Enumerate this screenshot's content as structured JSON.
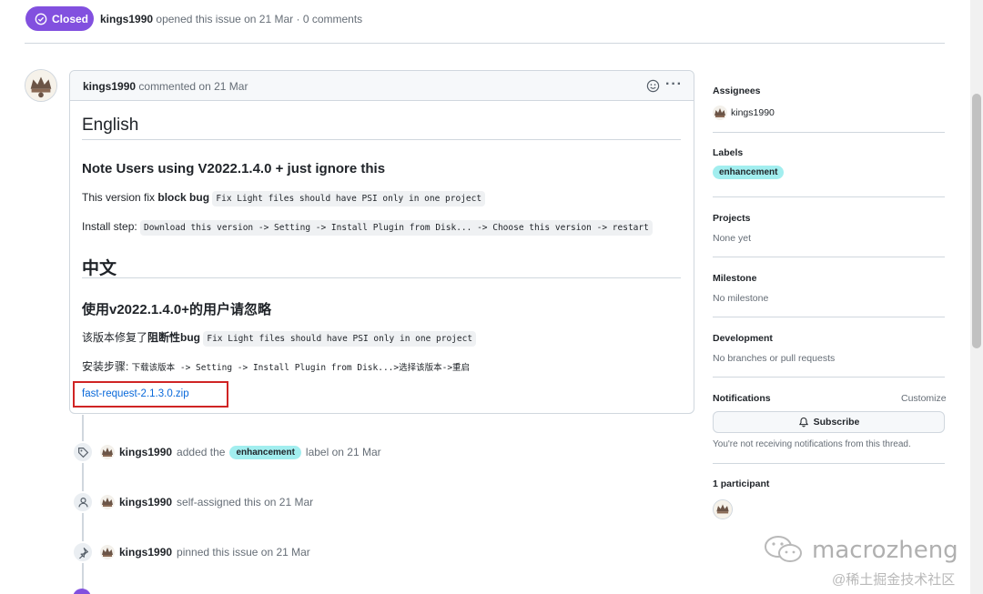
{
  "header": {
    "state": "Closed",
    "author": "kings1990",
    "meta": "opened this issue on 21 Mar · 0 comments"
  },
  "comment": {
    "author": "kings1990",
    "meta": "commented on 21 Mar",
    "more": "···",
    "h1_en": "English",
    "h2_en": "Note Users using V2022.1.4.0 + just ignore this",
    "p1_prefix": "This version fix ",
    "p1_bold": "block bug",
    "p1_code": "Fix Light files should have PSI only in one project",
    "p2_prefix": "Install step: ",
    "p2_code": "Download this version -> Setting -> Install Plugin from Disk... -> Choose this version -> restart",
    "h1_zh": "中文",
    "h2_zh": "使用v2022.1.4.0+的用户请忽略",
    "p3_prefix": "该版本修复了",
    "p3_bold": "阻断性bug",
    "p3_code": "Fix Light files should have PSI only in one project",
    "p4_prefix": "安装步骤: ",
    "p4_code": "下载该版本 -> Setting -> Install Plugin from Disk...>选择该版本->重启",
    "attachment": "fast-request-2.1.3.0.zip"
  },
  "timeline": [
    {
      "icon": "tag-icon",
      "user": "kings1990",
      "before": "added the",
      "label": "enhancement",
      "after": "label on 21 Mar"
    },
    {
      "icon": "person-icon",
      "user": "kings1990",
      "text": "self-assigned this on 21 Mar"
    },
    {
      "icon": "pin-icon",
      "user": "kings1990",
      "text": "pinned this issue on 21 Mar"
    }
  ],
  "sidebar": {
    "assignees_title": "Assignees",
    "assignee": "kings1990",
    "labels_title": "Labels",
    "label": "enhancement",
    "projects_title": "Projects",
    "projects_value": "None yet",
    "milestone_title": "Milestone",
    "milestone_value": "No milestone",
    "development_title": "Development",
    "development_value": "No branches or pull requests",
    "notifications_title": "Notifications",
    "customize": "Customize",
    "subscribe": "Subscribe",
    "notify_note": "You're not receiving notifications from this thread.",
    "participants_title": "1 participant"
  },
  "watermark": {
    "brand": "macrozheng",
    "site": "@稀土掘金技术社区"
  },
  "colors": {
    "closed": "#8250df",
    "label_bg": "#a2eeef",
    "link": "#0969da",
    "highlight": "#d02424"
  }
}
